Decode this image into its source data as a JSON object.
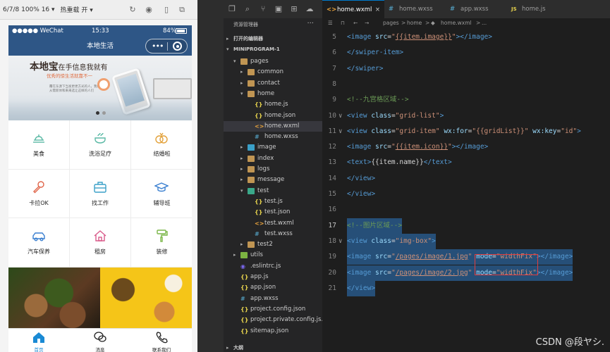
{
  "simulator": {
    "device_label": "6/7/8 100% 16 ▾",
    "mode_label": "热重载 开 ▾",
    "status": {
      "carrier": "●●●●● WeChat",
      "time": "15:33",
      "battery": "84%"
    },
    "nav_title": "本地生活",
    "banner": {
      "title": "本地宝",
      "title_small": "在手信息我就有",
      "subtitle": "优秀的惊生活就靠不一",
      "body": "覆在东源下当发更更方光的人，我们们从需新体和来来选让这样的人们"
    },
    "grid_items": [
      {
        "label": "美食",
        "icon": "food-icon"
      },
      {
        "label": "洗浴足疗",
        "icon": "bath-icon"
      },
      {
        "label": "结婚啦",
        "icon": "rings-icon"
      },
      {
        "label": "卡拉OK",
        "icon": "microphone-icon"
      },
      {
        "label": "找工作",
        "icon": "briefcase-icon"
      },
      {
        "label": "辅导班",
        "icon": "graduation-cap-icon"
      },
      {
        "label": "汽车保养",
        "icon": "car-icon"
      },
      {
        "label": "租房",
        "icon": "house-icon"
      },
      {
        "label": "装修",
        "icon": "paint-roller-icon"
      }
    ],
    "tabbar": [
      {
        "label": "首页",
        "icon": "home-icon",
        "active": true
      },
      {
        "label": "消息",
        "icon": "message-icon",
        "active": false
      },
      {
        "label": "联系我们",
        "icon": "phone-icon",
        "active": false
      }
    ],
    "colors": {
      "nav": "#2e5686",
      "icon": "#5bb9a5",
      "accent": "#1a8ad4"
    }
  },
  "explorer": {
    "title": "资源管理器",
    "more": "···",
    "open_editors": "打开的编辑器",
    "project": "MINIPROGRAM-1",
    "outline": "大纲",
    "tree": [
      {
        "name": "pages",
        "depth": 1,
        "type": "folder-open",
        "arrow": "▾"
      },
      {
        "name": "common",
        "depth": 2,
        "type": "folder",
        "arrow": "▸"
      },
      {
        "name": "contact",
        "depth": 2,
        "type": "folder",
        "arrow": "▸"
      },
      {
        "name": "home",
        "depth": 2,
        "type": "folder-open",
        "arrow": "▾"
      },
      {
        "name": "home.js",
        "depth": 3,
        "type": "js"
      },
      {
        "name": "home.json",
        "depth": 3,
        "type": "json"
      },
      {
        "name": "home.wxml",
        "depth": 3,
        "type": "wxml",
        "selected": true
      },
      {
        "name": "home.wxss",
        "depth": 3,
        "type": "wxss"
      },
      {
        "name": "image",
        "depth": 2,
        "type": "folder-img",
        "arrow": "▸"
      },
      {
        "name": "index",
        "depth": 2,
        "type": "folder",
        "arrow": "▸"
      },
      {
        "name": "logs",
        "depth": 2,
        "type": "folder",
        "arrow": "▸"
      },
      {
        "name": "message",
        "depth": 2,
        "type": "folder",
        "arrow": "▸"
      },
      {
        "name": "test",
        "depth": 2,
        "type": "folder-test",
        "arrow": "▾"
      },
      {
        "name": "test.js",
        "depth": 3,
        "type": "js"
      },
      {
        "name": "test.json",
        "depth": 3,
        "type": "json"
      },
      {
        "name": "test.wxml",
        "depth": 3,
        "type": "wxml"
      },
      {
        "name": "test.wxss",
        "depth": 3,
        "type": "wxss"
      },
      {
        "name": "test2",
        "depth": 2,
        "type": "folder",
        "arrow": "▸"
      },
      {
        "name": "utils",
        "depth": 1,
        "type": "folder-utils",
        "arrow": "▸"
      },
      {
        "name": ".eslintrc.js",
        "depth": 1,
        "type": "eslint"
      },
      {
        "name": "app.js",
        "depth": 1,
        "type": "js"
      },
      {
        "name": "app.json",
        "depth": 1,
        "type": "json"
      },
      {
        "name": "app.wxss",
        "depth": 1,
        "type": "wxss"
      },
      {
        "name": "project.config.json",
        "depth": 1,
        "type": "json"
      },
      {
        "name": "project.private.config.js...",
        "depth": 1,
        "type": "json"
      },
      {
        "name": "sitemap.json",
        "depth": 1,
        "type": "json"
      }
    ]
  },
  "editor": {
    "tabs": [
      {
        "label": "home.wxml",
        "badge": "<>",
        "active": true,
        "close": "×"
      },
      {
        "label": "home.wxss",
        "badge": "#",
        "active": false
      },
      {
        "label": "app.wxss",
        "badge": "#",
        "active": false
      },
      {
        "label": "home.js",
        "badge": "JS",
        "active": false
      }
    ],
    "breadcrumb": [
      "pages",
      ">",
      "home",
      ">",
      "home.wxml",
      ">",
      "..."
    ],
    "lines": [
      {
        "n": "5",
        "parts": [
          [
            "tag",
            "<image "
          ],
          [
            "attr",
            "src"
          ],
          [
            "txt",
            "="
          ],
          [
            "str",
            "\""
          ],
          [
            "str u",
            "{{item.image}}"
          ],
          [
            "str",
            "\""
          ],
          [
            "tag",
            "></image>"
          ]
        ]
      },
      {
        "n": "6",
        "parts": [
          [
            "tag",
            "</swiper-item>"
          ]
        ]
      },
      {
        "n": "7",
        "parts": [
          [
            "tag",
            "</swiper>"
          ]
        ]
      },
      {
        "n": "8",
        "parts": []
      },
      {
        "n": "9",
        "parts": [
          [
            "cm",
            "<!--九宫格区域-->"
          ]
        ]
      },
      {
        "n": "10",
        "fold": "∨",
        "parts": [
          [
            "tag",
            "<view "
          ],
          [
            "attr",
            "class"
          ],
          [
            "txt",
            "="
          ],
          [
            "str",
            "\"grid-list\""
          ],
          [
            "tag",
            ">"
          ]
        ]
      },
      {
        "n": "11",
        "fold": "∨",
        "parts": [
          [
            "tag",
            "<view "
          ],
          [
            "attr",
            "class"
          ],
          [
            "txt",
            "="
          ],
          [
            "str",
            "\"grid-item\" "
          ],
          [
            "attr",
            "wx:for"
          ],
          [
            "txt",
            "="
          ],
          [
            "str",
            "\"{{gridList}}\" "
          ],
          [
            "attr",
            "wx:key"
          ],
          [
            "txt",
            "="
          ],
          [
            "str",
            "\"id\""
          ],
          [
            "tag",
            ">"
          ]
        ]
      },
      {
        "n": "12",
        "parts": [
          [
            "tag",
            "<image "
          ],
          [
            "attr",
            "src"
          ],
          [
            "txt",
            "="
          ],
          [
            "str",
            "\""
          ],
          [
            "str u",
            "{{item.icon}}"
          ],
          [
            "str",
            "\""
          ],
          [
            "tag",
            "></image>"
          ]
        ]
      },
      {
        "n": "13",
        "parts": [
          [
            "tag",
            "<text>"
          ],
          [
            "txt",
            "{{item.name}}"
          ],
          [
            "tag",
            "</text>"
          ]
        ]
      },
      {
        "n": "14",
        "parts": [
          [
            "tag",
            "</view>"
          ]
        ]
      },
      {
        "n": "15",
        "parts": [
          [
            "tag",
            "</view>"
          ]
        ]
      },
      {
        "n": "16",
        "parts": []
      },
      {
        "n": "17",
        "cur": true,
        "hl": true,
        "parts": [
          [
            "cm",
            "<!--图片区域-->"
          ]
        ]
      },
      {
        "n": "18",
        "fold": "∨",
        "hl": true,
        "parts": [
          [
            "tag",
            "<view "
          ],
          [
            "attr",
            "class"
          ],
          [
            "txt",
            "="
          ],
          [
            "str",
            "\"img-box\""
          ],
          [
            "tag",
            ">"
          ]
        ]
      },
      {
        "n": "19",
        "hl": true,
        "parts": [
          [
            "tag",
            "<image "
          ],
          [
            "attr",
            "src"
          ],
          [
            "txt",
            "="
          ],
          [
            "str",
            "\""
          ],
          [
            "str u",
            "/pages/image/1.jpg"
          ],
          [
            "str",
            "\" "
          ],
          [
            "attr",
            "mode"
          ],
          [
            "txt",
            "="
          ],
          [
            "str",
            "\"widthFix\""
          ],
          [
            "tag",
            "></image>"
          ]
        ]
      },
      {
        "n": "20",
        "hl": true,
        "parts": [
          [
            "tag",
            "<image "
          ],
          [
            "attr",
            "src"
          ],
          [
            "txt",
            "="
          ],
          [
            "str",
            "\""
          ],
          [
            "str u",
            "/pages/image/2.jpg"
          ],
          [
            "str",
            "\" "
          ],
          [
            "attr",
            "mode"
          ],
          [
            "txt",
            "="
          ],
          [
            "str",
            "\"widthFix\""
          ],
          [
            "tag",
            "></image>"
          ]
        ]
      },
      {
        "n": "21",
        "hl": true,
        "parts": [
          [
            "tag",
            "</view>"
          ]
        ]
      }
    ],
    "watermark": "CSDN @段ヤシ."
  }
}
